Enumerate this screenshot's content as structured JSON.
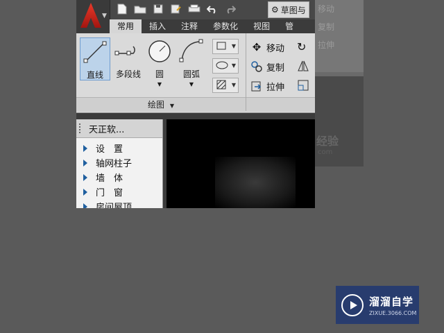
{
  "quick_access": {
    "icons": [
      "new-file-icon",
      "open-folder-icon",
      "save-icon",
      "save-as-icon",
      "print-icon",
      "undo-icon",
      "redo-icon"
    ],
    "workspace_label": "草图与"
  },
  "tabs": [
    {
      "label": "常用",
      "active": true
    },
    {
      "label": "插入"
    },
    {
      "label": "注释"
    },
    {
      "label": "参数化"
    },
    {
      "label": "视图"
    },
    {
      "label": "管"
    }
  ],
  "draw_tools": [
    {
      "label": "直线",
      "selected": true
    },
    {
      "label": "多段线"
    },
    {
      "label": "圆"
    },
    {
      "label": "圆弧"
    }
  ],
  "draw_panel_title": "绘图",
  "modify_tools": [
    {
      "label": "移动"
    },
    {
      "label": "复制"
    },
    {
      "label": "拉伸"
    }
  ],
  "palette": {
    "title": "天正软...",
    "items": [
      "设　置",
      "轴网柱子",
      "墙　体",
      "门　窗",
      "房间屋顶"
    ]
  },
  "ghost": {
    "labels": [
      "移动",
      "复制",
      "拉伸"
    ],
    "mark": "经验",
    "url": "com"
  },
  "badge": {
    "name": "溜溜自学",
    "url": "ZIXUE.3066.COM"
  },
  "colors": {
    "accent": "#283c6e",
    "selected": "#bcd3ea",
    "logo": "#d32a1a"
  }
}
